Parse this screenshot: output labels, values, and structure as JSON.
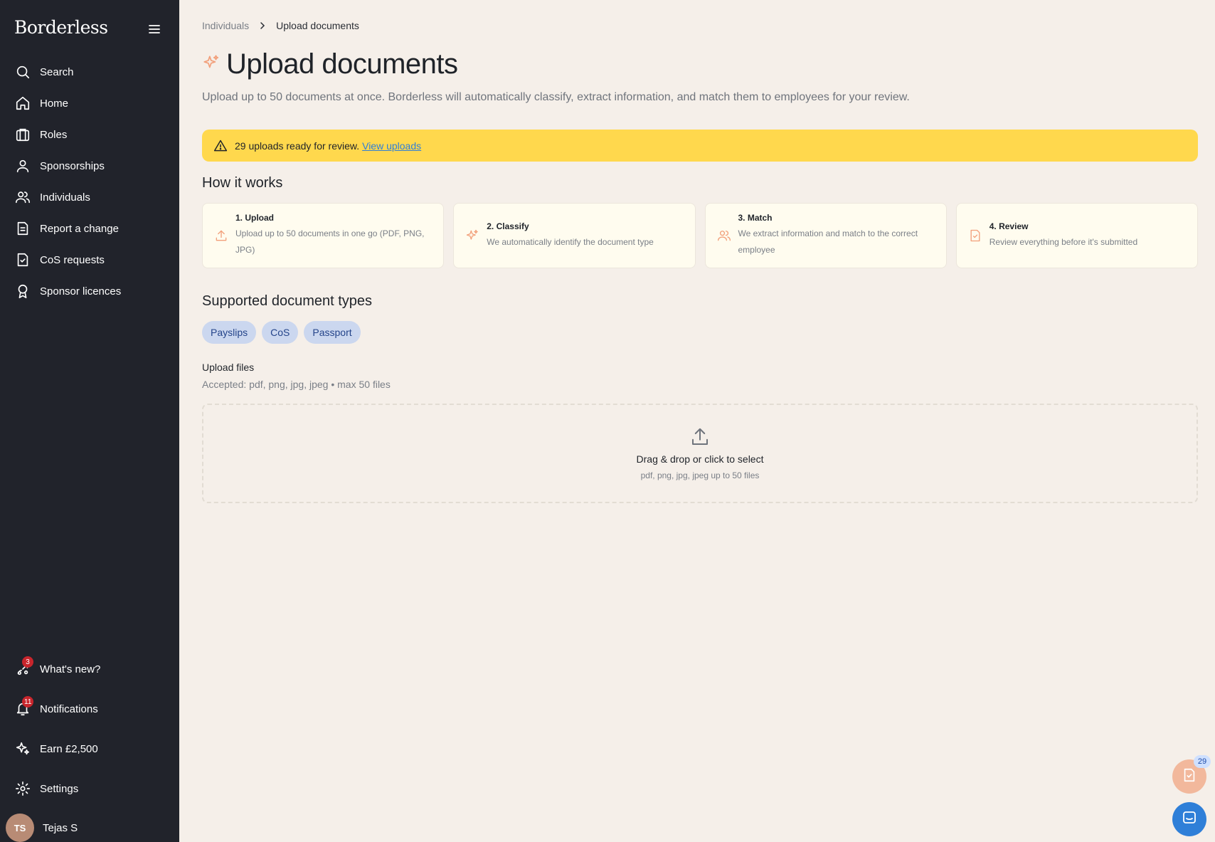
{
  "app": {
    "brand": "Borderless"
  },
  "sidebar": {
    "items": [
      {
        "label": "Search",
        "icon": "search-icon"
      },
      {
        "label": "Home",
        "icon": "home-icon"
      },
      {
        "label": "Roles",
        "icon": "briefcase-icon"
      },
      {
        "label": "Sponsorships",
        "icon": "user-icon"
      },
      {
        "label": "Individuals",
        "icon": "users-icon"
      },
      {
        "label": "Report a change",
        "icon": "document-icon"
      },
      {
        "label": "CoS requests",
        "icon": "file-check-icon"
      },
      {
        "label": "Sponsor licences",
        "icon": "award-icon"
      }
    ],
    "bottom_items": [
      {
        "label": "What's new?",
        "icon": "rocket-icon",
        "badge": "3"
      },
      {
        "label": "Notifications",
        "icon": "bell-icon",
        "badge": "11"
      },
      {
        "label": "Earn £2,500",
        "icon": "sparkles-icon"
      },
      {
        "label": "Settings",
        "icon": "gear-icon"
      }
    ],
    "user": {
      "initials": "TS",
      "name": "Tejas S"
    }
  },
  "breadcrumb": {
    "parent": "Individuals",
    "current": "Upload documents"
  },
  "page": {
    "title": "Upload documents",
    "subtitle": "Upload up to 50 documents at once. Borderless will automatically classify, extract information, and match them to employees for your review."
  },
  "alert": {
    "text": "29 uploads ready for review.",
    "link": "View uploads"
  },
  "how_it_works": {
    "heading": "How it works",
    "steps": [
      {
        "title": "1. Upload",
        "desc": "Upload up to 50 documents in one go (PDF, PNG, JPG)",
        "icon": "upload-icon"
      },
      {
        "title": "2. Classify",
        "desc": "We automatically identify the document type",
        "icon": "sparkle-icon"
      },
      {
        "title": "3. Match",
        "desc": "We extract information and match to the correct employee",
        "icon": "users-icon"
      },
      {
        "title": "4. Review",
        "desc": "Review everything before it's submitted",
        "icon": "file-check-icon"
      }
    ]
  },
  "supported": {
    "heading": "Supported document types",
    "types": [
      "Payslips",
      "CoS",
      "Passport"
    ]
  },
  "upload": {
    "label": "Upload files",
    "accepted": "Accepted: pdf, png, jpg, jpeg • max 50 files",
    "drop_title": "Drag & drop or click to select",
    "drop_sub": "pdf, png, jpg, jpeg up to 50 files"
  },
  "floating": {
    "docs_badge": "29"
  },
  "colors": {
    "sidebar_bg": "#21232b",
    "page_bg": "#f5efe9",
    "alert_bg": "#ffd84d",
    "accent_orange": "#f2a07b",
    "link_blue": "#2f7fd8",
    "chip_bg": "#cbd7ef"
  }
}
